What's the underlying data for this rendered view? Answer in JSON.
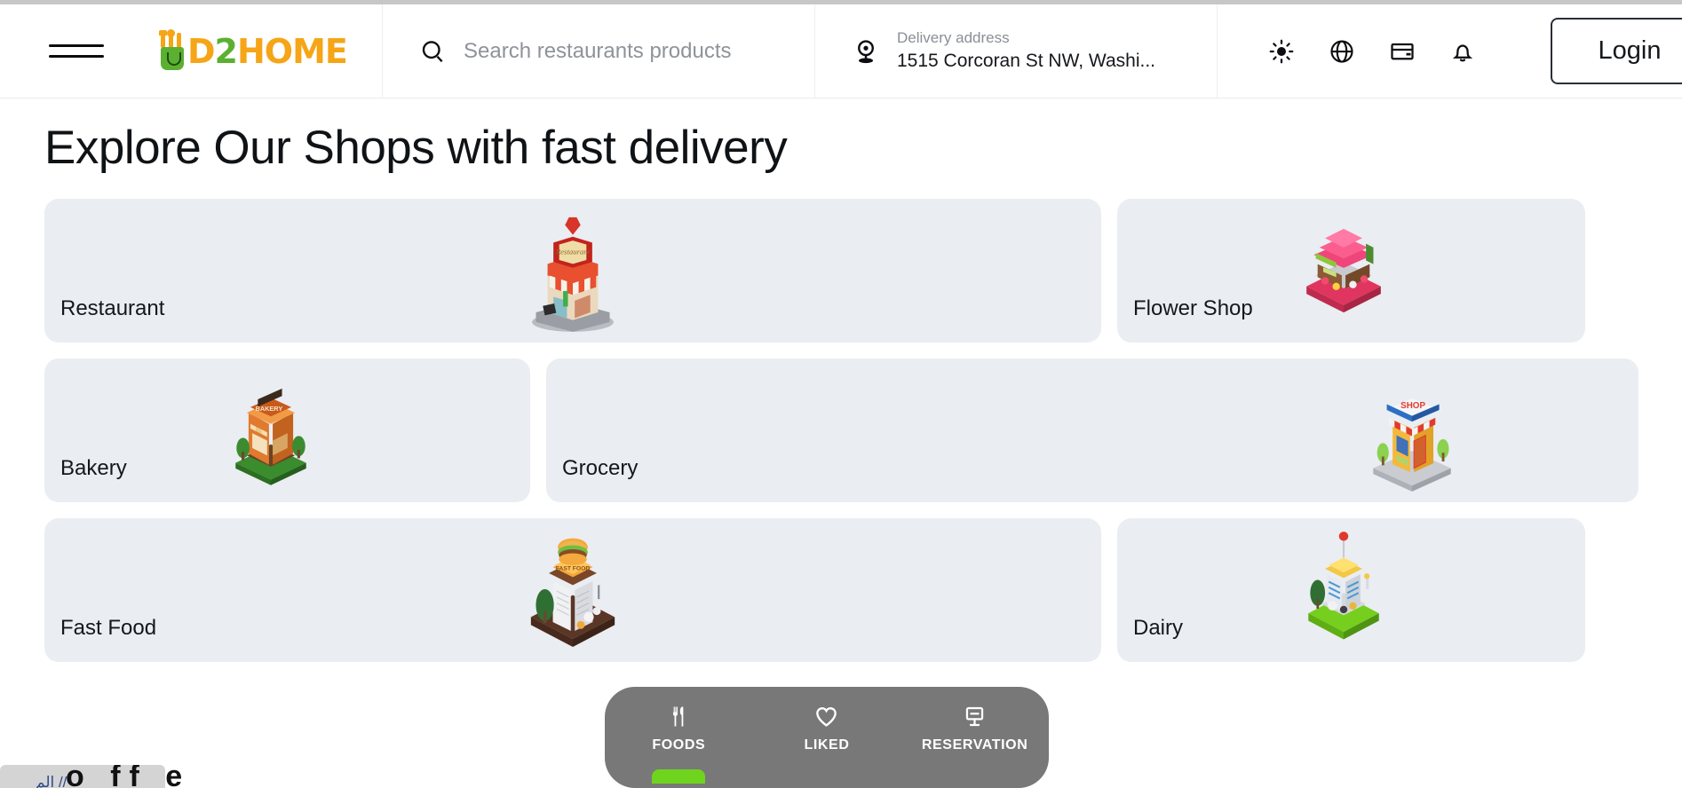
{
  "header": {
    "menu_icon": "hamburger-menu-icon",
    "logo": {
      "part1": "D",
      "part2": "2",
      "part3": "HOME",
      "full": "D2HOME"
    },
    "search": {
      "icon": "search-icon",
      "placeholder": "Search restaurants products",
      "value": ""
    },
    "address": {
      "icon": "location-pin-icon",
      "label": "Delivery address",
      "value": "1515 Corcoran St NW, Washi..."
    },
    "actions": [
      {
        "name": "theme-toggle-icon",
        "title": "Light mode"
      },
      {
        "name": "language-globe-icon",
        "title": "Language"
      },
      {
        "name": "wallet-card-icon",
        "title": "Payments"
      },
      {
        "name": "notification-bell-icon",
        "title": "Notifications"
      }
    ],
    "login_label": "Login"
  },
  "main": {
    "title": "Explore Our Shops with fast delivery",
    "rows": [
      [
        {
          "label": "Restaurant",
          "art": "restaurant-storefront-art",
          "width": "wide",
          "art_pos": "center"
        },
        {
          "label": "Flower Shop",
          "art": "flower-shop-storefront-art",
          "width": "narrow",
          "art_pos": "flower"
        }
      ],
      [
        {
          "label": "Bakery",
          "art": "bakery-storefront-art",
          "width": "mid",
          "art_pos": "left"
        },
        {
          "label": "Grocery",
          "art": "grocery-shop-storefront-art",
          "width": "xwide",
          "art_pos": "right"
        }
      ],
      [
        {
          "label": "Fast Food",
          "art": "fast-food-storefront-art",
          "width": "wide",
          "art_pos": "center"
        },
        {
          "label": "Dairy",
          "art": "dairy-shop-storefront-art",
          "width": "narrow",
          "art_pos": "flower"
        }
      ]
    ]
  },
  "bottom_nav": {
    "items": [
      {
        "label": "FOODS",
        "icon": "fork-knife-icon",
        "active": true
      },
      {
        "label": "LIKED",
        "icon": "heart-icon",
        "active": false
      },
      {
        "label": "RESERVATION",
        "icon": "reservation-table-sign-icon",
        "active": false
      }
    ],
    "active_color": "#6fd41d",
    "background": "#787878"
  },
  "corner_widget": {
    "text": "الم // ",
    "glyphs": "o ff  e"
  },
  "colors": {
    "card_bg": "#eaedf2",
    "logo_orange": "#f5a516",
    "logo_green": "#5cb031",
    "text_primary": "#14171b",
    "text_muted": "#8a8f96"
  }
}
